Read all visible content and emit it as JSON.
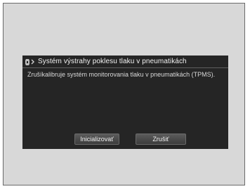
{
  "dialog": {
    "title": "Systém výstrahy poklesu tlaku v pneumatikách",
    "icon": "tire-pressure-warning-icon",
    "message": "Zrušíkalibruje systém monitorovania tlaku v pneumatikách (TPMS).",
    "buttons": {
      "initialize": "Inicializovať",
      "cancel": "Zrušiť"
    }
  }
}
